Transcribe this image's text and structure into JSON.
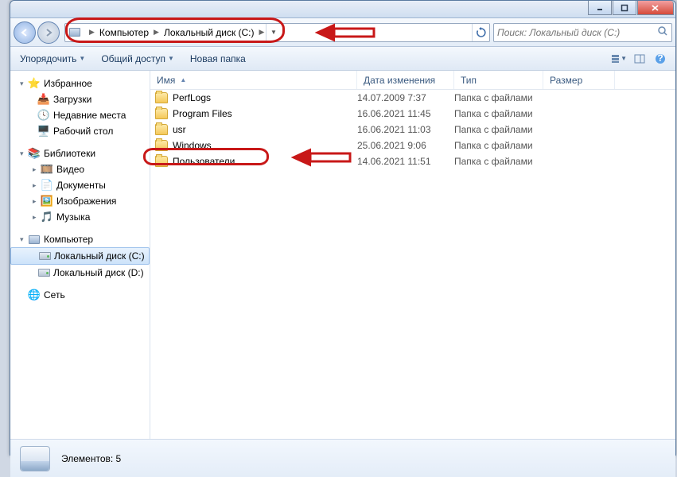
{
  "breadcrumb": {
    "root": "Компьютер",
    "drive": "Локальный диск (C:)"
  },
  "search": {
    "placeholder": "Поиск: Локальный диск (C:)"
  },
  "toolbar": {
    "organize": "Упорядочить",
    "share": "Общий доступ",
    "newfolder": "Новая папка"
  },
  "sidebar": {
    "favorites": "Избранное",
    "downloads": "Загрузки",
    "recent": "Недавние места",
    "desktop": "Рабочий стол",
    "libraries": "Библиотеки",
    "video": "Видео",
    "documents": "Документы",
    "pictures": "Изображения",
    "music": "Музыка",
    "computer": "Компьютер",
    "driveC": "Локальный диск (C:)",
    "driveD": "Локальный диск (D:)",
    "network": "Сеть"
  },
  "columns": {
    "name": "Имя",
    "date": "Дата изменения",
    "type": "Тип",
    "size": "Размер"
  },
  "files": [
    {
      "name": "PerfLogs",
      "date": "14.07.2009 7:37",
      "type": "Папка с файлами"
    },
    {
      "name": "Program Files",
      "date": "16.06.2021 11:45",
      "type": "Папка с файлами"
    },
    {
      "name": "usr",
      "date": "16.06.2021 11:03",
      "type": "Папка с файлами"
    },
    {
      "name": "Windows",
      "date": "25.06.2021 9:06",
      "type": "Папка с файлами"
    },
    {
      "name": "Пользователи",
      "date": "14.06.2021 11:51",
      "type": "Папка с файлами"
    }
  ],
  "status": {
    "count": "Элементов: 5"
  }
}
